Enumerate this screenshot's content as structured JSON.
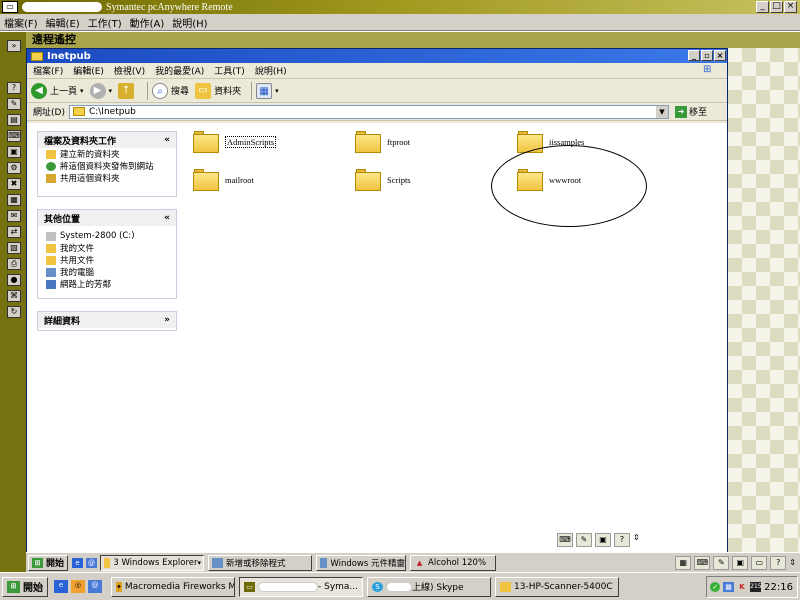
{
  "outer_window": {
    "title": "Symantec pcAnywhere Remote",
    "menu": [
      "檔案(F)",
      "編輯(E)",
      "工作(T)",
      "動作(A)",
      "說明(H)"
    ],
    "controls": [
      "_",
      "□",
      "×"
    ]
  },
  "remote_header": "遠程遙控",
  "explorer": {
    "title": "Inetpub",
    "controls": [
      "_",
      "▫",
      "×"
    ],
    "menu": [
      "檔案(F)",
      "編輯(E)",
      "檢視(V)",
      "我的最愛(A)",
      "工具(T)",
      "說明(H)"
    ],
    "toolbar": {
      "back": "上一頁",
      "search": "搜尋",
      "folders": "資料夾"
    },
    "address_label": "網址(D)",
    "address_value": "C:\\Inetpub",
    "go_label": "移至",
    "file_tasks": {
      "title": "檔案及資料夾工作",
      "items": [
        "建立新的資料夾",
        "將這個資料夾發佈到網站",
        "共用這個資料夾"
      ]
    },
    "other_places": {
      "title": "其他位置",
      "items": [
        "System-2800 (C:)",
        "我的文件",
        "共用文件",
        "我的電腦",
        "網路上的芳鄰"
      ]
    },
    "details": {
      "title": "詳細資料"
    },
    "folders": [
      "AdminScripts",
      "ftproot",
      "iissamples",
      "mailroot",
      "Scripts",
      "wwwroot"
    ]
  },
  "remote_taskbar": {
    "start": "開始",
    "tasks": [
      "3 Windows Explorer",
      "新增或移除程式",
      "Windows 元件精靈",
      "Alcohol 120%"
    ]
  },
  "local_taskbar": {
    "start": "開始",
    "tasks": [
      "Macromedia Fireworks M...",
      "- Syma...",
      "上線) Skype",
      "13-HP-Scanner-5400C"
    ],
    "tray_badge": "215",
    "clock": "22:16"
  }
}
